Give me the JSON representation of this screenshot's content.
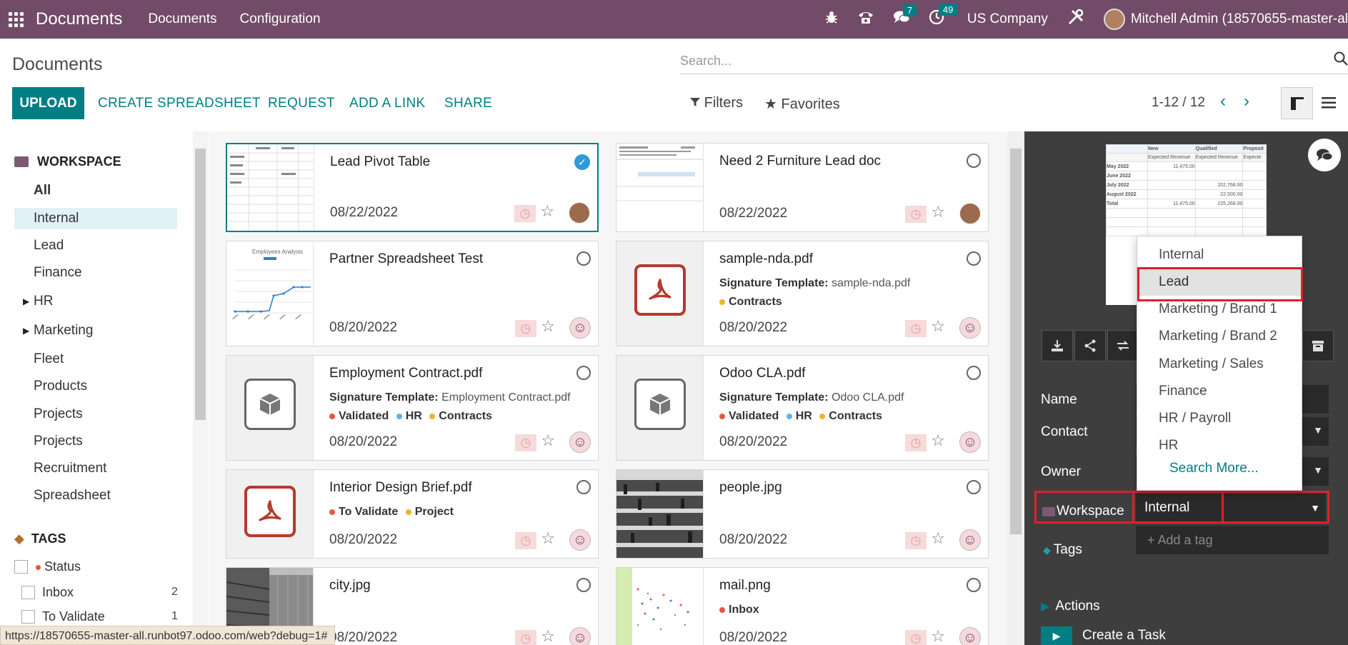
{
  "navbar": {
    "app_name": "Documents",
    "menus": [
      "Documents",
      "Configuration"
    ],
    "messages_count": "7",
    "activities_count": "49",
    "company": "US Company",
    "user": "Mitchell Admin (18570655-master-al"
  },
  "control_panel": {
    "title": "Documents",
    "search_placeholder": "Search...",
    "upload_label": "UPLOAD",
    "create_spreadsheet_label": "CREATE SPREADSHEET",
    "request_label": "REQUEST",
    "add_link_label": "ADD A LINK",
    "share_label": "SHARE",
    "filters_label": "Filters",
    "favorites_label": "Favorites",
    "pager": "1-12 / 12"
  },
  "sidebar": {
    "workspace_heading": "WORKSPACE",
    "workspaces": [
      {
        "label": "All"
      },
      {
        "label": "Internal"
      },
      {
        "label": "Lead"
      },
      {
        "label": "Finance"
      },
      {
        "label": "HR"
      },
      {
        "label": "Marketing"
      },
      {
        "label": "Fleet"
      },
      {
        "label": "Products"
      },
      {
        "label": "Projects"
      },
      {
        "label": "Projects"
      },
      {
        "label": "Recruitment"
      },
      {
        "label": "Spreadsheet"
      }
    ],
    "tags_heading": "TAGS",
    "status_label": "Status",
    "tag_items": [
      {
        "label": "Inbox",
        "count": "2"
      },
      {
        "label": "To Validate",
        "count": "1"
      }
    ]
  },
  "documents": [
    {
      "title": "Lead Pivot Table",
      "date": "08/22/2022",
      "thumb": "pivot"
    },
    {
      "title": "Need 2 Furniture Lead doc",
      "date": "08/22/2022",
      "thumb": "doc"
    },
    {
      "title": "Partner Spreadsheet Test",
      "date": "08/20/2022",
      "thumb": "chart",
      "thumb_title": "Employees Analysis"
    },
    {
      "title": "sample-nda.pdf",
      "date": "08/20/2022",
      "thumb": "pdf",
      "sig_label": "Signature Template:",
      "sig_value": "sample-nda.pdf",
      "tags": [
        {
          "label": "Contracts",
          "color": "#f0b429"
        }
      ]
    },
    {
      "title": "Employment Contract.pdf",
      "date": "08/20/2022",
      "thumb": "box",
      "sig_label": "Signature Template:",
      "sig_value": "Employment Contract.pdf",
      "tags": [
        {
          "label": "Validated",
          "color": "#e8563f"
        },
        {
          "label": "HR",
          "color": "#5bb5e8"
        },
        {
          "label": "Contracts",
          "color": "#f0b429"
        }
      ]
    },
    {
      "title": "Odoo CLA.pdf",
      "date": "08/20/2022",
      "thumb": "box",
      "sig_label": "Signature Template:",
      "sig_value": "Odoo CLA.pdf",
      "tags": [
        {
          "label": "Validated",
          "color": "#e8563f"
        },
        {
          "label": "HR",
          "color": "#5bb5e8"
        },
        {
          "label": "Contracts",
          "color": "#f0b429"
        }
      ]
    },
    {
      "title": "Interior Design Brief.pdf",
      "date": "08/20/2022",
      "thumb": "pdf",
      "tags": [
        {
          "label": "To Validate",
          "color": "#e8563f"
        },
        {
          "label": "Project",
          "color": "#f0b429"
        }
      ]
    },
    {
      "title": "people.jpg",
      "date": "08/20/2022",
      "thumb": "photo"
    },
    {
      "title": "city.jpg",
      "date": "08/20/2022",
      "thumb": "city"
    },
    {
      "title": "mail.png",
      "date": "08/20/2022",
      "thumb": "scatter",
      "tags": [
        {
          "label": "Inbox",
          "color": "#e8563f"
        }
      ]
    }
  ],
  "inspector": {
    "preview_headers": [
      "New",
      "Qualified",
      "Proposit"
    ],
    "preview_subheaders": [
      "Expected Revenue",
      "Expected Revenue",
      "Expecte"
    ],
    "preview_rows": [
      {
        "label": "May 2022",
        "new": "11,475.00",
        "qual": ""
      },
      {
        "label": "June 2022",
        "new": "",
        "qual": ""
      },
      {
        "label": "July 2022",
        "new": "",
        "qual": "202,768.00"
      },
      {
        "label": "August 2022",
        "new": "",
        "qual": "22,500.00"
      },
      {
        "label": "Total",
        "new": "11,475.00",
        "qual": "225,268.00"
      }
    ],
    "name_label": "Name",
    "contact_label": "Contact",
    "owner_label": "Owner",
    "workspace_label": "Workspace",
    "workspace_value": "Internal",
    "tags_label": "Tags",
    "tags_placeholder": "+ Add a tag",
    "actions_label": "Actions",
    "create_task_label": "Create a Task"
  },
  "dropdown": {
    "options": [
      "Internal",
      "Lead",
      "Marketing / Brand 1",
      "Marketing / Brand 2",
      "Marketing / Sales",
      "Finance",
      "HR / Payroll",
      "HR"
    ],
    "highlighted": "Lead",
    "search_more": "Search More..."
  },
  "status_url": "https://18570655-master-all.runbot97.odoo.com/web?debug=1#",
  "colors": {
    "brand": "#714B67",
    "accent": "#017E84",
    "highlight_box": "#e0202a"
  }
}
